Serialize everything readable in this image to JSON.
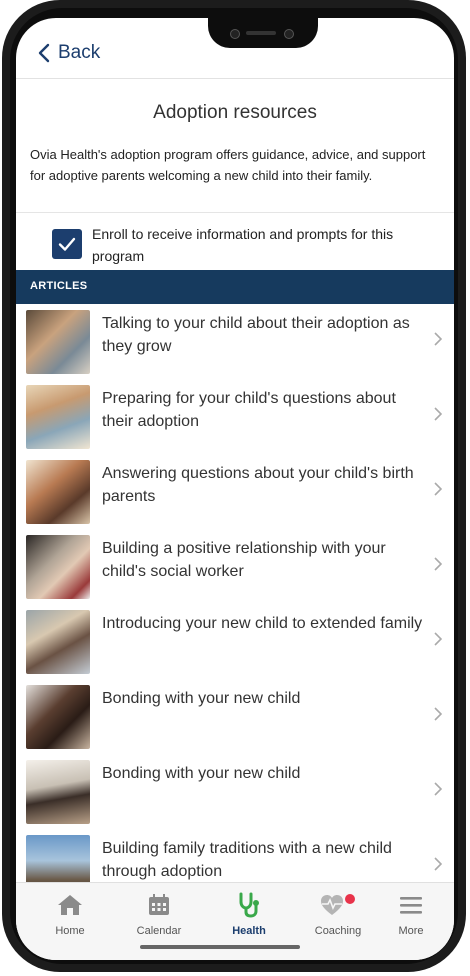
{
  "nav": {
    "back_label": "Back"
  },
  "page": {
    "title": "Adoption resources",
    "description": "Ovia Health's adoption program offers guidance, advice, and support for adoptive parents welcoming a new child into their family."
  },
  "enroll": {
    "checked": true,
    "label": "Enroll to receive information and prompts for this program"
  },
  "section": {
    "header": "ARTICLES"
  },
  "articles": [
    {
      "title": "Talking to your child about their adoption as they grow"
    },
    {
      "title": "Preparing for your child's questions about their adoption"
    },
    {
      "title": "Answering questions about your child's birth parents"
    },
    {
      "title": "Building a positive relationship with your child's social worker"
    },
    {
      "title": "Introducing your new child to extended family"
    },
    {
      "title": "Bonding with your new child"
    },
    {
      "title": "Bonding with your new child"
    },
    {
      "title": "Building family traditions with a new child through adoption"
    }
  ],
  "tabs": [
    {
      "label": "Home",
      "icon": "home-icon"
    },
    {
      "label": "Calendar",
      "icon": "calendar-icon"
    },
    {
      "label": "Health",
      "icon": "stethoscope-icon"
    },
    {
      "label": "Coaching",
      "icon": "heartbeat-icon"
    },
    {
      "label": "More",
      "icon": "menu-icon"
    }
  ],
  "colors": {
    "brand": "#1c3e6e",
    "health_green": "#39a84a",
    "notification": "#e8334a"
  }
}
